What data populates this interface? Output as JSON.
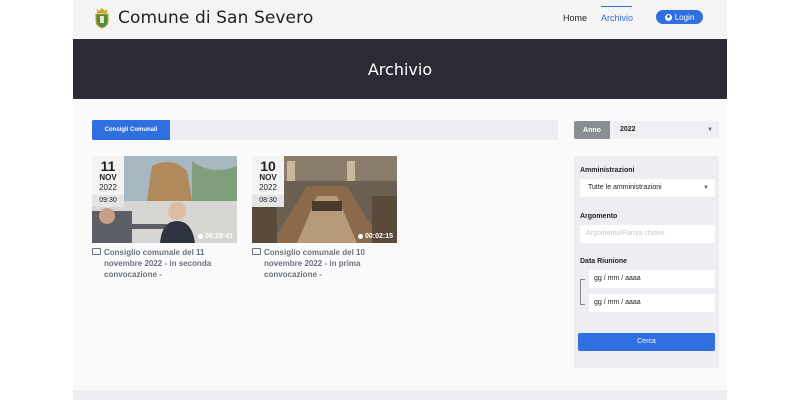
{
  "header": {
    "site_title": "Comune di San Severo",
    "nav": {
      "home": "Home",
      "archivio": "Archivio"
    },
    "login_label": "Login"
  },
  "banner": {
    "title": "Archivio"
  },
  "tabs": [
    {
      "label": "Consigli Comunali",
      "active": true
    }
  ],
  "cards": [
    {
      "day": "11",
      "month": "NOV",
      "year": "2022",
      "time": "09:30",
      "duration": "06:29:41",
      "title": "Consiglio comunale del 11 novembre 2022 - in seconda convocazione -"
    },
    {
      "day": "10",
      "month": "NOV",
      "year": "2022",
      "time": "08:30",
      "duration": "00:02:15",
      "title": "Consiglio comunale del 10 novembre 2022 - in prima convocazione -"
    }
  ],
  "filters": {
    "anno_label": "Anno",
    "anno_value": "2022",
    "amministrazioni_label": "Amministrazioni",
    "amministrazioni_value": "Tutte le amministrazioni",
    "argomento_label": "Argomento",
    "argomento_placeholder": "Argomento/Parola chiave",
    "data_label": "Data Riunione",
    "date_from_placeholder": "gg / mm / aaaa",
    "date_to_placeholder": "gg / mm / aaaa",
    "search_label": "Cerca"
  },
  "colors": {
    "accent": "#2f6fe0",
    "banner": "#2b2b36"
  }
}
